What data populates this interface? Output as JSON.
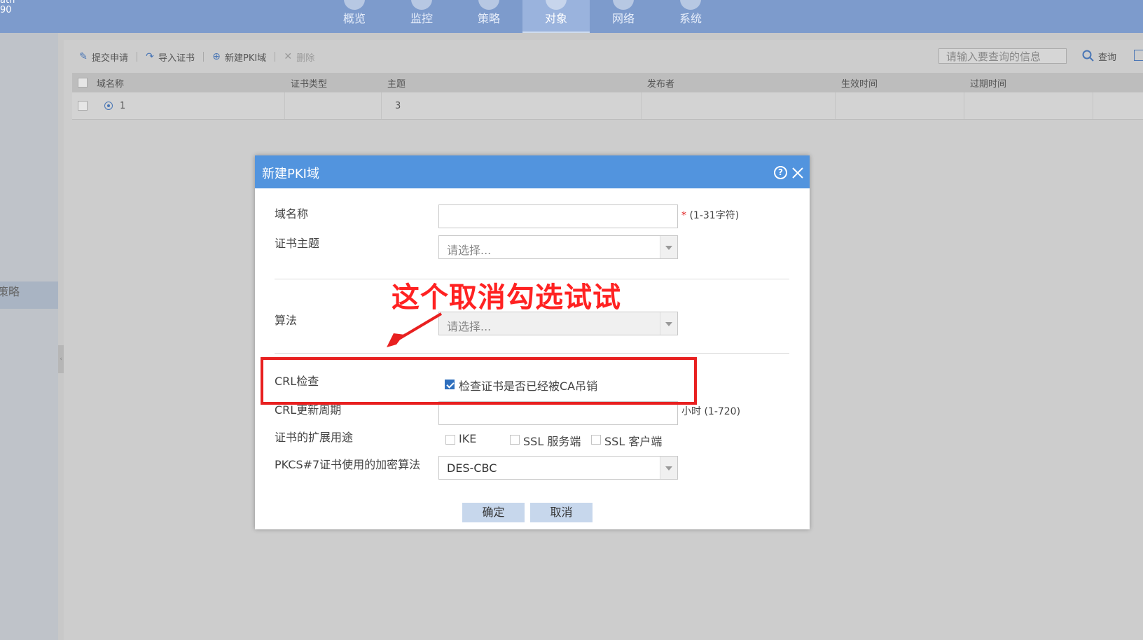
{
  "brand": {
    "line1": "ath",
    "line2": "90"
  },
  "nav": {
    "items": [
      {
        "label": "概览"
      },
      {
        "label": "监控"
      },
      {
        "label": "策略"
      },
      {
        "label": "对象"
      },
      {
        "label": "网络"
      },
      {
        "label": "系统"
      }
    ],
    "active": "对象"
  },
  "sidebar": {
    "partial_item": "策略",
    "collapse_glyph": "‹"
  },
  "toolbar": {
    "submit_label": "提交申请",
    "import_label": "导入证书",
    "new_label": "新建PKI域",
    "delete_label": "删除"
  },
  "search": {
    "placeholder": "请输入要查询的信息",
    "button_label": "查询"
  },
  "table": {
    "columns": [
      "域名称",
      "证书类型",
      "主题",
      "发布者",
      "生效时间",
      "过期时间"
    ],
    "rows": [
      {
        "name": "1",
        "type": "",
        "subject": "3",
        "issuer": "",
        "start": "",
        "end": ""
      }
    ]
  },
  "dialog": {
    "title": "新建PKI域",
    "help_glyph": "?",
    "fields": {
      "domain_name": {
        "label": "域名称",
        "required_mark": "*",
        "hint": "(1-31字符)",
        "value": ""
      },
      "cert_subject": {
        "label": "证书主题",
        "value": "请选择..."
      },
      "algorithm": {
        "label": "算法",
        "value": "请选择..."
      },
      "crl_check": {
        "label": "CRL检查",
        "checkbox_label": "检查证书是否已经被CA吊销",
        "checked": true
      },
      "crl_period": {
        "label": "CRL更新周期",
        "unit_hint": "小时 (1-720)",
        "value": ""
      },
      "ext_usage": {
        "label": "证书的扩展用途",
        "options": [
          {
            "label": "IKE",
            "checked": false
          },
          {
            "label": "SSL 服务端",
            "checked": false
          },
          {
            "label": "SSL 客户端",
            "checked": false
          }
        ]
      },
      "pkcs7": {
        "label": "PKCS#7证书使用的加密算法",
        "value": "DES-CBC"
      }
    },
    "ok_label": "确定",
    "cancel_label": "取消"
  },
  "annotation": {
    "text": "这个取消勾选试试",
    "color": "#ff2222"
  },
  "colors": {
    "accent": "#5294de",
    "topbar": "#7d9bcc",
    "annotation_red": "#e82020"
  }
}
